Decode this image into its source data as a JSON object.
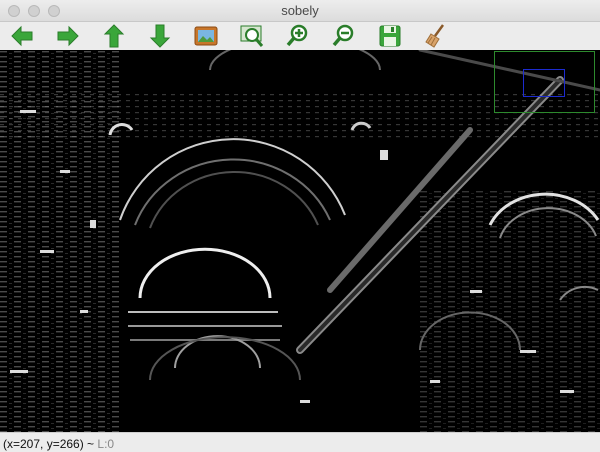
{
  "window": {
    "title": "sobely"
  },
  "toolbar": {
    "buttons": [
      {
        "name": "back",
        "icon": "arrow-left-icon"
      },
      {
        "name": "forward",
        "icon": "arrow-right-icon"
      },
      {
        "name": "up",
        "icon": "arrow-up-icon"
      },
      {
        "name": "down",
        "icon": "arrow-down-icon"
      },
      {
        "name": "image",
        "icon": "picture-icon"
      },
      {
        "name": "zoom-fit",
        "icon": "zoom-image-icon"
      },
      {
        "name": "zoom-in",
        "icon": "zoom-in-icon"
      },
      {
        "name": "zoom-out",
        "icon": "zoom-out-icon"
      },
      {
        "name": "save",
        "icon": "save-icon"
      },
      {
        "name": "clear",
        "icon": "broom-icon"
      }
    ]
  },
  "status": {
    "coords": "(x=207, y=266) ~",
    "level": "L:0"
  },
  "colors": {
    "arrow_green": "#3aa63a",
    "minimap_border": "#2d8a2d",
    "minimap_selection": "#1c2bd0"
  }
}
